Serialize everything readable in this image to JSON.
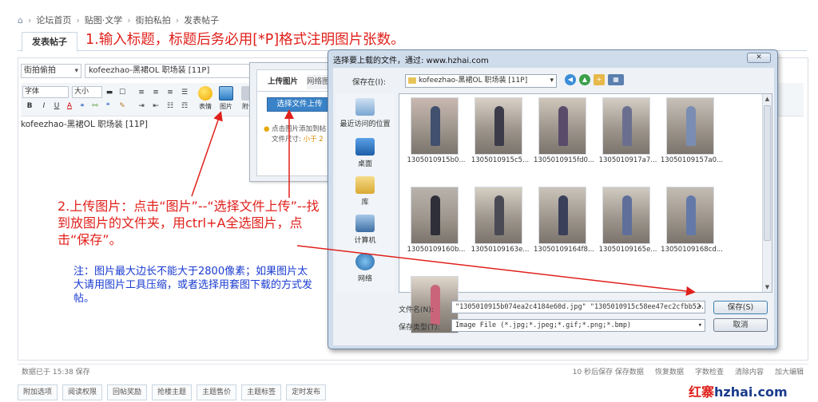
{
  "breadcrumb": [
    "论坛首页",
    "贴图·文学",
    "街拍私拍",
    "发表帖子"
  ],
  "tab_post": "发表帖子",
  "category": "街拍偷拍",
  "title_value": "kofeezhao-黑裙OL 职场装 [11P]",
  "editor_text": "kofeezhao-黑裙OL 职场装 [11P]",
  "toolbar": {
    "font_select": "字体",
    "size_select": "大小",
    "bold": "B",
    "italic": "I",
    "underline": "U",
    "color": "A",
    "emoji_label": "表情",
    "image_label": "图片",
    "attach_label": "附件"
  },
  "annotations": {
    "step1": "1.输入标题，标题后务必用[*P]格式注明图片张数。",
    "step2": "2.上传图片：点击“图片”--“选择文件上传”--找到放图片的文件夹，用ctrl+A全选图片，点击“保存”。",
    "note": "注：图片最大边长不能大于2800像素；如果图片太大请用图片工具压缩，或者选择用套图下载的方式发帖。"
  },
  "upload_popup": {
    "tab_upload": "上传图片",
    "tab_web": "网络图",
    "choose_button": "选择文件上传",
    "hint_line1": "点击图片添加到帖",
    "hint_line2_prefix": "文件尺寸: ",
    "hint_line2_value": "小于 2"
  },
  "dialog": {
    "title": "选择要上载的文件，通过: www.hzhai.com",
    "close": "✕",
    "save_in_label": "保存在(I):",
    "save_in_value": "kofeezhao-黑裙OL 职场装 [11P]",
    "places": [
      "最近访问的位置",
      "桌面",
      "库",
      "计算机",
      "网络"
    ],
    "files": [
      "1305010915b0...",
      "1305010915c5...",
      "1305010915fd0...",
      "1305010917a7...",
      "13050109157a0...",
      "13050109160b...",
      "13050109163e...",
      "13050109164f8...",
      "13050109165e...",
      "13050109168cd...",
      ""
    ],
    "filename_label": "文件名(N):",
    "filename_value": "\"1305010915b074ea2c4184e60d.jpg\" \"1305010915c58ee47ec2cfbb52.jpg\"",
    "filetype_label": "保存类型(T):",
    "filetype_value": "Image File (*.jpg;*.jpeg;*.gif;*.png;*.bmp)",
    "save_button": "保存(S)",
    "cancel_button": "取消"
  },
  "status_bar": {
    "left": "数据已于 15:38 保存",
    "right": [
      "10 秒后保存 保存数据",
      "恢复数据",
      "字数检查",
      "清除内容",
      "加大编辑"
    ]
  },
  "bottom_tabs": [
    "附加选项",
    "阅读权限",
    "回帖奖励",
    "抢楼主题",
    "主题售价",
    "主题标签",
    "定时发布"
  ],
  "watermark": {
    "part1": "红寨",
    "part2": "hzhai.com"
  },
  "colors": {
    "annotation_red": "#e0201b",
    "annotation_blue": "#1a3bd0",
    "button_blue": "#3a83c8"
  }
}
